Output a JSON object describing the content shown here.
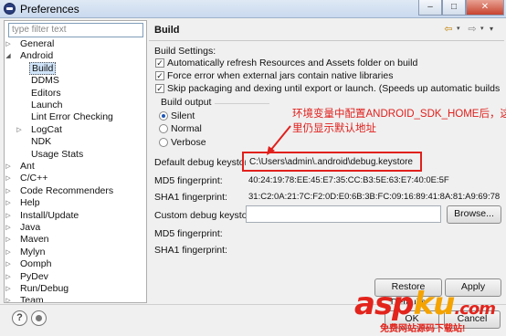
{
  "window": {
    "title": "Preferences",
    "controls": {
      "minimize": "–",
      "maximize": "□",
      "close": "✕"
    }
  },
  "sidebar": {
    "filter_placeholder": "type filter text",
    "items": [
      {
        "label": "General",
        "indent": 0,
        "twisty": "▷"
      },
      {
        "label": "Android",
        "indent": 0,
        "twisty": "◢"
      },
      {
        "label": "Build",
        "indent": 1,
        "twisty": "",
        "selected": true
      },
      {
        "label": "DDMS",
        "indent": 1,
        "twisty": ""
      },
      {
        "label": "Editors",
        "indent": 1,
        "twisty": ""
      },
      {
        "label": "Launch",
        "indent": 1,
        "twisty": ""
      },
      {
        "label": "Lint Error Checking",
        "indent": 1,
        "twisty": ""
      },
      {
        "label": "LogCat",
        "indent": 1,
        "twisty": "▷"
      },
      {
        "label": "NDK",
        "indent": 1,
        "twisty": ""
      },
      {
        "label": "Usage Stats",
        "indent": 1,
        "twisty": ""
      },
      {
        "label": "Ant",
        "indent": 0,
        "twisty": "▷"
      },
      {
        "label": "C/C++",
        "indent": 0,
        "twisty": "▷"
      },
      {
        "label": "Code Recommenders",
        "indent": 0,
        "twisty": "▷"
      },
      {
        "label": "Help",
        "indent": 0,
        "twisty": "▷"
      },
      {
        "label": "Install/Update",
        "indent": 0,
        "twisty": "▷"
      },
      {
        "label": "Java",
        "indent": 0,
        "twisty": "▷"
      },
      {
        "label": "Maven",
        "indent": 0,
        "twisty": "▷"
      },
      {
        "label": "Mylyn",
        "indent": 0,
        "twisty": "▷"
      },
      {
        "label": "Oomph",
        "indent": 0,
        "twisty": "▷"
      },
      {
        "label": "PyDev",
        "indent": 0,
        "twisty": "▷"
      },
      {
        "label": "Run/Debug",
        "indent": 0,
        "twisty": "▷"
      },
      {
        "label": "Team",
        "indent": 0,
        "twisty": "▷"
      }
    ]
  },
  "page": {
    "title": "Build",
    "nav": {
      "back_icon": "⇦",
      "forward_icon": "⇨",
      "drop": "▾",
      "menu": "▾"
    },
    "build_settings_label": "Build Settings:",
    "checkboxes": [
      {
        "label": "Automatically refresh Resources and Assets folder on build",
        "checked": true
      },
      {
        "label": "Force error when external jars contain native libraries",
        "checked": true
      },
      {
        "label": "Skip packaging and dexing until export or launch. (Speeds up automatic builds on file save)",
        "checked": true
      }
    ],
    "build_output_label": "Build output",
    "radios": [
      {
        "label": "Silent",
        "selected": true
      },
      {
        "label": "Normal",
        "selected": false
      },
      {
        "label": "Verbose",
        "selected": false
      }
    ],
    "default_keystore_label": "Default debug keystore:",
    "default_keystore_value": "C:\\Users\\admin\\.android\\debug.keystore",
    "md5_label": "MD5 fingerprint:",
    "md5_value": "40:24:19:78:EE:45:E7:35:CC:B3:5E:63:E7:40:0E:5F",
    "sha1_label": "SHA1 fingerprint:",
    "sha1_value": "31:C2:0A:21:7C:F2:0D:E0:6B:3B:FC:09:16:89:41:8A:81:A9:69:78",
    "custom_keystore_label": "Custom debug keystore:",
    "custom_keystore_value": "",
    "browse_label": "Browse...",
    "md5_label_2": "MD5 fingerprint:",
    "sha1_label_2": "SHA1 fingerprint:",
    "restore_defaults_label": "Restore Defaults",
    "apply_label": "Apply"
  },
  "annotation": {
    "line1": "环境变量中配置ANDROID_SDK_HOME后，这",
    "line2": "里仍显示默认地址",
    "color": "#e0201c"
  },
  "footer": {
    "help_icon": "?",
    "ok_label": "OK",
    "cancel_label": "Cancel"
  },
  "watermark": {
    "brand_a": "asp",
    "brand_b": "ku",
    "brand_c": ".com",
    "tagline": "免费网站源码下载站!"
  }
}
